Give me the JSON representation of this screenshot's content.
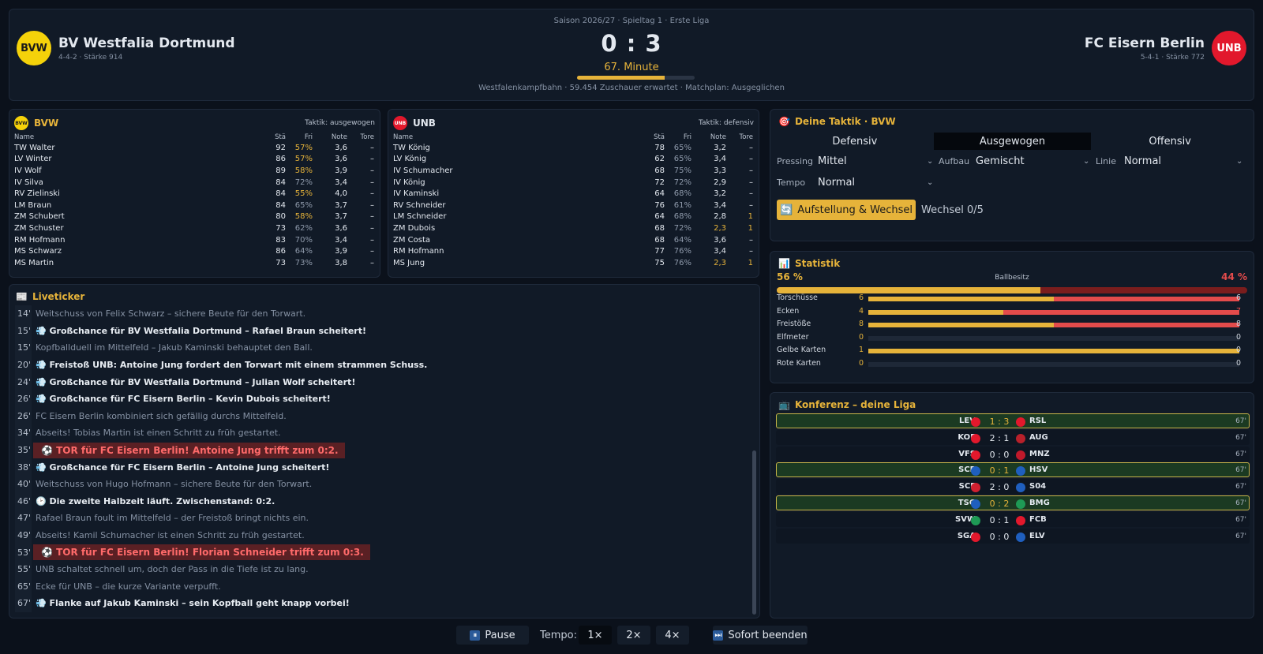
{
  "header": {
    "season": "Saison 2026/27 · Spieltag 1 · Erste Liga",
    "home": {
      "crest": "BVW",
      "name": "BV Westfalia Dortmund",
      "sub": "4-4-2 · Stärke 914",
      "color": "#f5d20a"
    },
    "away": {
      "crest": "UNB",
      "name": "FC Eisern Berlin",
      "sub": "5-4-1 · Stärke 772",
      "color": "#e2182c"
    },
    "score": "0 : 3",
    "minute_label": "67. Minute",
    "minute_progress": 0.744,
    "venue": "Westfalenkampfbahn · 59.454 Zuschauer erwartet · Matchplan: Ausgeglichen"
  },
  "lineups": {
    "columns": [
      "Name",
      "Stä",
      "Fri",
      "Note",
      "Tore"
    ],
    "home": {
      "crest": "BVW",
      "label": "BVW",
      "tactic": "Taktik: ausgewogen",
      "players": [
        {
          "name": "TW  Walter",
          "sta": "92",
          "fri": "57%",
          "note": "3,6",
          "tore": "–",
          "fri_hi": true
        },
        {
          "name": "LV  Winter",
          "sta": "86",
          "fri": "57%",
          "note": "3,6",
          "tore": "–",
          "fri_hi": true
        },
        {
          "name": "IV  Wolf",
          "sta": "89",
          "fri": "58%",
          "note": "3,9",
          "tore": "–",
          "fri_hi": true
        },
        {
          "name": "IV  Silva",
          "sta": "84",
          "fri": "72%",
          "note": "3,4",
          "tore": "–"
        },
        {
          "name": "RV  Zielinski",
          "sta": "84",
          "fri": "55%",
          "note": "4,0",
          "tore": "–",
          "fri_hi": true
        },
        {
          "name": "LM  Braun",
          "sta": "84",
          "fri": "65%",
          "note": "3,7",
          "tore": "–"
        },
        {
          "name": "ZM  Schubert",
          "sta": "80",
          "fri": "58%",
          "note": "3,7",
          "tore": "–",
          "fri_hi": true
        },
        {
          "name": "ZM  Schuster",
          "sta": "73",
          "fri": "62%",
          "note": "3,6",
          "tore": "–"
        },
        {
          "name": "RM  Hofmann",
          "sta": "83",
          "fri": "70%",
          "note": "3,4",
          "tore": "–"
        },
        {
          "name": "MS  Schwarz",
          "sta": "86",
          "fri": "64%",
          "note": "3,9",
          "tore": "–"
        },
        {
          "name": "MS  Martin",
          "sta": "73",
          "fri": "73%",
          "note": "3,8",
          "tore": "–"
        }
      ]
    },
    "away": {
      "crest": "UNB",
      "label": "UNB",
      "tactic": "Taktik: defensiv",
      "players": [
        {
          "name": "TW  König",
          "sta": "78",
          "fri": "65%",
          "note": "3,2",
          "tore": "–"
        },
        {
          "name": "LV  König",
          "sta": "62",
          "fri": "65%",
          "note": "3,4",
          "tore": "–"
        },
        {
          "name": "IV  Schumacher",
          "sta": "68",
          "fri": "75%",
          "note": "3,3",
          "tore": "–"
        },
        {
          "name": "IV  König",
          "sta": "72",
          "fri": "72%",
          "note": "2,9",
          "tore": "–"
        },
        {
          "name": "IV  Kaminski",
          "sta": "64",
          "fri": "68%",
          "note": "3,2",
          "tore": "–"
        },
        {
          "name": "RV  Schneider",
          "sta": "76",
          "fri": "61%",
          "note": "3,4",
          "tore": "–"
        },
        {
          "name": "LM  Schneider",
          "sta": "64",
          "fri": "68%",
          "note": "2,8",
          "tore": "1",
          "tore_hi": true
        },
        {
          "name": "ZM  Dubois",
          "sta": "68",
          "fri": "72%",
          "note": "2,3",
          "tore": "1",
          "note_hi": true,
          "tore_hi": true
        },
        {
          "name": "ZM  Costa",
          "sta": "68",
          "fri": "64%",
          "note": "3,6",
          "tore": "–"
        },
        {
          "name": "RM  Hofmann",
          "sta": "77",
          "fri": "76%",
          "note": "3,4",
          "tore": "–"
        },
        {
          "name": "MS  Jung",
          "sta": "75",
          "fri": "76%",
          "note": "2,3",
          "tore": "1",
          "note_hi": true,
          "tore_hi": true
        }
      ]
    }
  },
  "ticker": {
    "title": "Liveticker",
    "events": [
      {
        "min": "14'",
        "text": "Weitschuss von Felix Schwarz – sichere Beute für den Torwart.",
        "kind": "dim"
      },
      {
        "min": "15'",
        "text": "💨 Großchance für BV Westfalia Dortmund – Rafael Braun scheitert!",
        "kind": "ev"
      },
      {
        "min": "15'",
        "text": "Kopfballduell im Mittelfeld – Jakub Kaminski behauptet den Ball.",
        "kind": "dim"
      },
      {
        "min": "20'",
        "text": "💨 Freistoß UNB: Antoine Jung fordert den Torwart mit einem strammen Schuss.",
        "kind": "ev"
      },
      {
        "min": "24'",
        "text": "💨 Großchance für BV Westfalia Dortmund – Julian Wolf scheitert!",
        "kind": "ev"
      },
      {
        "min": "26'",
        "text": "💨 Großchance für FC Eisern Berlin – Kevin Dubois scheitert!",
        "kind": "ev"
      },
      {
        "min": "26'",
        "text": "FC Eisern Berlin kombiniert sich gefällig durchs Mittelfeld.",
        "kind": "dim"
      },
      {
        "min": "34'",
        "text": "Abseits! Tobias Martin ist einen Schritt zu früh gestartet.",
        "kind": "dim"
      },
      {
        "min": "35'",
        "text": "⚽ TOR für FC Eisern Berlin! Antoine Jung trifft zum 0:2.",
        "kind": "goal"
      },
      {
        "min": "38'",
        "text": "💨 Großchance für FC Eisern Berlin – Antoine Jung scheitert!",
        "kind": "ev"
      },
      {
        "min": "40'",
        "text": "Weitschuss von Hugo Hofmann – sichere Beute für den Torwart.",
        "kind": "dim"
      },
      {
        "min": "46'",
        "text": "🕑 Die zweite Halbzeit läuft. Zwischenstand: 0:2.",
        "kind": "ev"
      },
      {
        "min": "47'",
        "text": "Rafael Braun foult im Mittelfeld – der Freistoß bringt nichts ein.",
        "kind": "dim"
      },
      {
        "min": "49'",
        "text": "Abseits! Kamil Schumacher ist einen Schritt zu früh gestartet.",
        "kind": "dim"
      },
      {
        "min": "53'",
        "text": "⚽ TOR für FC Eisern Berlin! Florian Schneider trifft zum 0:3.",
        "kind": "goal"
      },
      {
        "min": "55'",
        "text": "UNB schaltet schnell um, doch der Pass in die Tiefe ist zu lang.",
        "kind": "dim"
      },
      {
        "min": "65'",
        "text": "Ecke für UNB – die kurze Variante verpufft.",
        "kind": "dim"
      },
      {
        "min": "67'",
        "text": "💨 Flanke auf Jakub Kaminski – sein Kopfball geht knapp vorbei!",
        "kind": "ev"
      }
    ]
  },
  "tactics": {
    "title": "Deine Taktik · BVW",
    "modes": [
      "Defensiv",
      "Ausgewogen",
      "Offensiv"
    ],
    "active_mode": 1,
    "pressing_label": "Pressing",
    "pressing_value": "Mittel",
    "aufbau_label": "Aufbau",
    "aufbau_value": "Gemischt",
    "linie_label": "Linie",
    "linie_value": "Normal",
    "tempo_label": "Tempo",
    "tempo_value": "Normal",
    "lineup_button": "Aufstellung & Wechsel",
    "subs": "Wechsel 0/5"
  },
  "stats": {
    "title": "Statistik",
    "possession_label": "Ballbesitz",
    "possession_home": "56 %",
    "possession_away": "44 %",
    "possession_home_value": 56,
    "rows": [
      {
        "label": "Torschüsse",
        "home": "6",
        "away": "6",
        "h": 6,
        "a": 6
      },
      {
        "label": "Ecken",
        "home": "4",
        "away": "7",
        "h": 4,
        "a": 7,
        "away_hi": true
      },
      {
        "label": "Freistöße",
        "home": "8",
        "away": "8",
        "h": 8,
        "a": 8
      },
      {
        "label": "Elfmeter",
        "home": "0",
        "away": "0",
        "h": 0,
        "a": 0
      },
      {
        "label": "Gelbe Karten",
        "home": "1",
        "away": "0",
        "h": 1,
        "a": 0
      },
      {
        "label": "Rote Karten",
        "home": "0",
        "away": "0",
        "h": 0,
        "a": 0
      }
    ]
  },
  "conference": {
    "title": "Konferenz – deine Liga",
    "matches": [
      {
        "home": "LEV",
        "away": "RSL",
        "score": "1 : 3",
        "min": "67'",
        "hl": true,
        "hc": "#e2182c",
        "ac": "#e2182c"
      },
      {
        "home": "KOE",
        "away": "AUG",
        "score": "2 : 1",
        "min": "67'",
        "hl": false,
        "hc": "#e2182c",
        "ac": "#b8202a"
      },
      {
        "home": "VFS",
        "away": "MNZ",
        "score": "0 : 0",
        "min": "67'",
        "hl": false,
        "hc": "#e2182c",
        "ac": "#c0192b"
      },
      {
        "home": "SCP",
        "away": "HSV",
        "score": "0 : 1",
        "min": "67'",
        "hl": true,
        "hc": "#1f5fbf",
        "ac": "#1f5fbf"
      },
      {
        "home": "SCF",
        "away": "S04",
        "score": "2 : 0",
        "min": "67'",
        "hl": false,
        "hc": "#d02030",
        "ac": "#1f5fbf"
      },
      {
        "home": "TSG",
        "away": "BMG",
        "score": "0 : 2",
        "min": "67'",
        "hl": true,
        "hc": "#1f5fbf",
        "ac": "#1e9a55"
      },
      {
        "home": "SVW",
        "away": "FCB",
        "score": "0 : 1",
        "min": "67'",
        "hl": false,
        "hc": "#1e9a55",
        "ac": "#e2182c"
      },
      {
        "home": "SGA",
        "away": "ELV",
        "score": "0 : 0",
        "min": "67'",
        "hl": false,
        "hc": "#e2182c",
        "ac": "#1f5fbf"
      }
    ]
  },
  "controls": {
    "pause": "Pause",
    "tempo_label": "Tempo:",
    "speeds": [
      "1×",
      "2×",
      "4×"
    ],
    "finish": "Sofort beenden"
  }
}
